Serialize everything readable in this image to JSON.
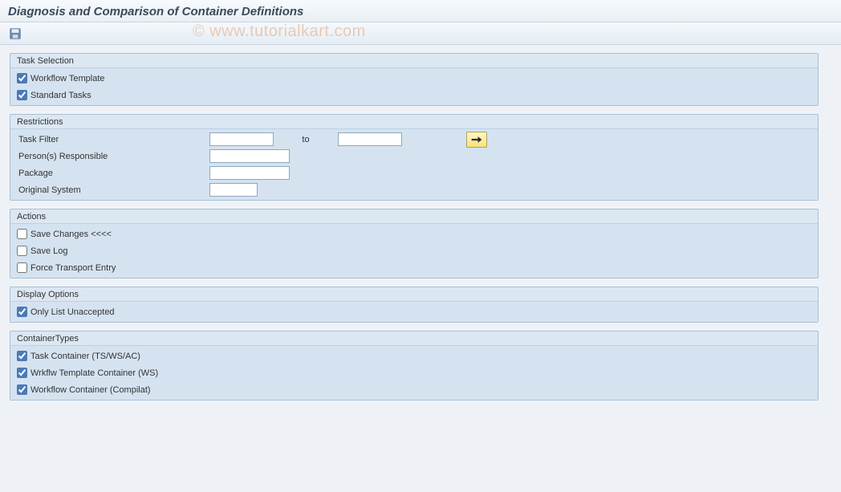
{
  "title": "Diagnosis and Comparison of Container Definitions",
  "watermark": "© www.tutorialkart.com",
  "groups": {
    "task_selection": {
      "title": "Task Selection",
      "workflow_template": "Workflow Template",
      "standard_tasks": "Standard Tasks"
    },
    "restrictions": {
      "title": "Restrictions",
      "task_filter": "Task Filter",
      "to": "to",
      "persons_responsible": "Person(s) Responsible",
      "package": "Package",
      "original_system": "Original System"
    },
    "actions": {
      "title": "Actions",
      "save_changes": "Save Changes <<<<",
      "save_log": "Save Log",
      "force_transport": "Force Transport Entry"
    },
    "display_options": {
      "title": "Display Options",
      "only_list_unaccepted": "Only List Unaccepted"
    },
    "container_types": {
      "title": "ContainerTypes",
      "task_container": "Task Container (TS/WS/AC)",
      "wrkflw_template_container": "Wrkflw Template Container (WS)",
      "workflow_container": "Workflow Container (Compilat)"
    }
  }
}
